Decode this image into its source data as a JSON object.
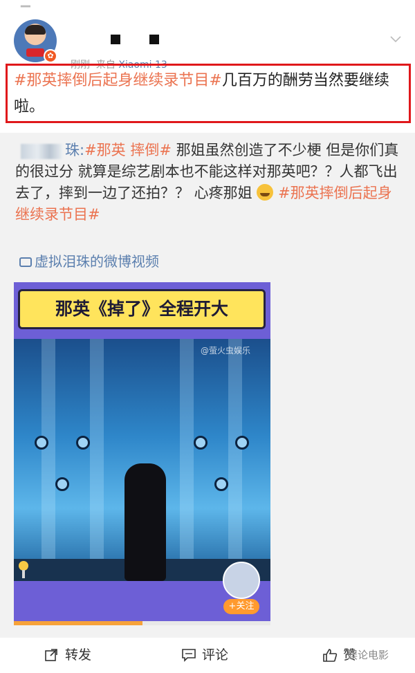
{
  "post": {
    "username_masked": "■ ■",
    "time": "刚刚",
    "source_prefix": "来自",
    "device": "Xiaomi 13",
    "hashtag": "#那英摔倒后起身继续录节目#",
    "text": "几百万的酬劳当然要继续啦。"
  },
  "repost": {
    "author_suffix": "珠:",
    "hashtag_1": "#那英 摔倒#",
    "text_1": " 那姐虽然创造了不少梗 但是你们真的很过分 就算是综艺剧本也不能这样对那英吧？？人都飞出去了，摔到一边了还拍？？ 心疼那姐",
    "emoji": "crying-face-emoji",
    "hashtag_2": "#那英摔倒后起身继续录节目#",
    "video_link": "虚拟泪珠的微博视频",
    "video": {
      "title": "那英《掉了》全程开大",
      "watermark": "@萤火虫娱乐",
      "follow_label": "+关注",
      "progress_fraction": 0.5
    }
  },
  "actions": {
    "repost": "转发",
    "comment": "评论",
    "like": "赞"
  },
  "watermark": "娱论电影",
  "colors": {
    "accent_orange": "#eb7350",
    "link_blue": "#5b7fae",
    "highlight_red": "#e0181b"
  }
}
